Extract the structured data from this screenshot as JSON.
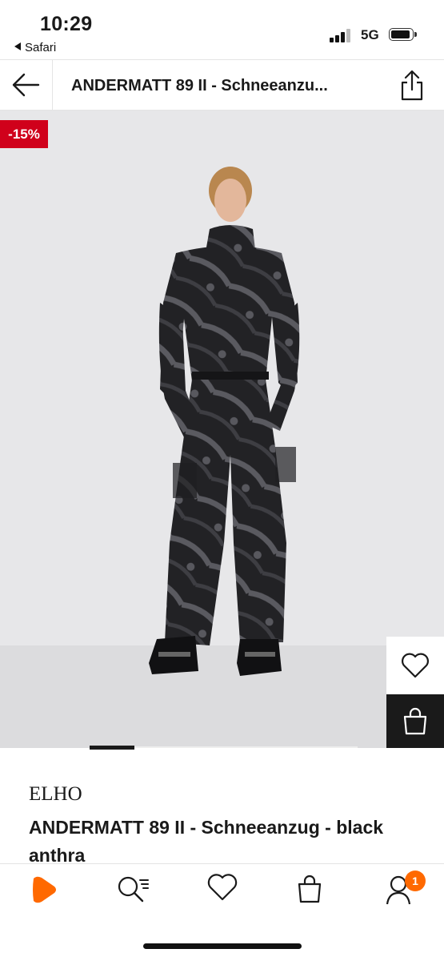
{
  "status_bar": {
    "time": "10:29",
    "back_app_label": "Safari",
    "network": "5G"
  },
  "header": {
    "title": "ANDERMATT 89 II - Schneeanzu...",
    "back_icon": "arrow-left-icon",
    "share_icon": "share-icon"
  },
  "gallery": {
    "discount_badge": "-15%",
    "image_count": 6,
    "active_index": 0,
    "wishlist_icon": "heart-icon",
    "add_to_cart_icon": "shopping-bag-icon"
  },
  "product": {
    "brand": "ELHO",
    "title": "ANDERMATT 89 II - Schneeanzug - black anthra"
  },
  "tab_bar": {
    "items": [
      {
        "name": "home",
        "icon": "zalando-play-icon"
      },
      {
        "name": "search",
        "icon": "search-icon"
      },
      {
        "name": "wishlist",
        "icon": "heart-icon"
      },
      {
        "name": "bag",
        "icon": "shopping-bag-icon"
      },
      {
        "name": "account",
        "icon": "user-icon"
      }
    ],
    "account_badge": "1"
  },
  "colors": {
    "accent": "#ff6900",
    "sale_badge": "#d0011b",
    "text": "#1a1a1a"
  }
}
